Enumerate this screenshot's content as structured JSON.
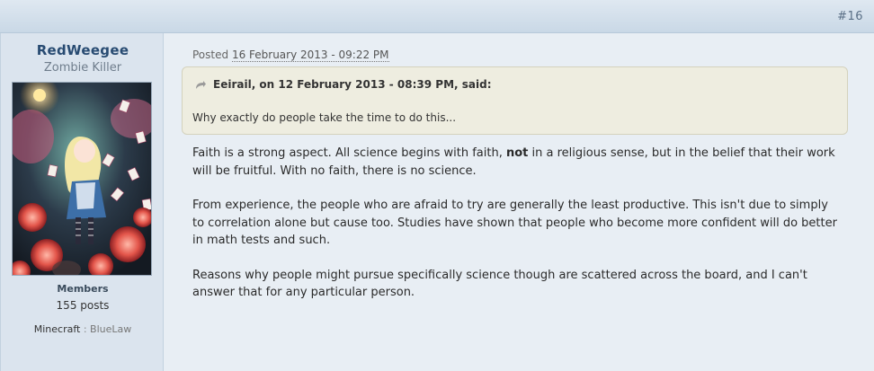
{
  "post": {
    "number": "#16",
    "posted_label": "Posted",
    "posted_date": "16 February 2013 - 09:22 PM"
  },
  "author": {
    "name": "RedWeegee",
    "title": "Zombie Killer",
    "group": "Members",
    "posts": "155 posts",
    "custom_field_label": "Minecraft",
    "custom_field_sep": " : ",
    "custom_field_value": "BlueLaw"
  },
  "quote": {
    "citation": "Eeirail, on 12 February 2013 - 08:39 PM, said:",
    "text": "Why exactly do people take the time to do this..."
  },
  "body": {
    "p1_before": "Faith is a strong aspect. All science begins with faith, ",
    "p1_bold": "not",
    "p1_after": " in a religious sense, but in the belief that their work will be fruitful. With no faith, there is no science.",
    "p2": "From experience, the people who are afraid to try are generally the least productive. This isn't due to simply to correlation alone but cause too. Studies have shown that people who become more confident will do better in math tests and such.",
    "p3": "Reasons why people might pursue specifically science though are scattered across the board, and I can't answer that for any particular person."
  },
  "colors": {
    "header_bg": "#c9d8e6",
    "author_bg": "#dbe4ee",
    "content_bg": "#e8eef4",
    "quote_bg": "#eeede0",
    "author_name": "#284b72"
  }
}
